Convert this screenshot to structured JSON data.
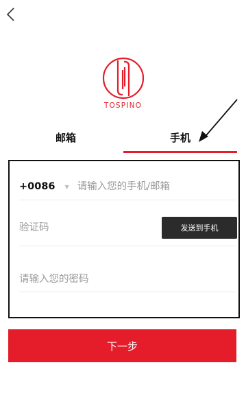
{
  "header": {
    "back_icon": "chevron-left-icon"
  },
  "logo": {
    "brand_text": "TOSPINO",
    "brand_color": "#e51d2a"
  },
  "tabs": [
    {
      "label": "邮箱",
      "active": false
    },
    {
      "label": "手机",
      "active": true
    }
  ],
  "annotation": {
    "icon": "arrow-icon",
    "color": "#111111"
  },
  "form": {
    "country_code": "+0086",
    "phone_placeholder": "请输入您的手机/邮箱",
    "code_placeholder": "验证码",
    "send_code_label": "发送到手机",
    "password_placeholder": "请输入您的密码"
  },
  "next_button": {
    "label": "下一步",
    "color": "#e51d2a"
  }
}
